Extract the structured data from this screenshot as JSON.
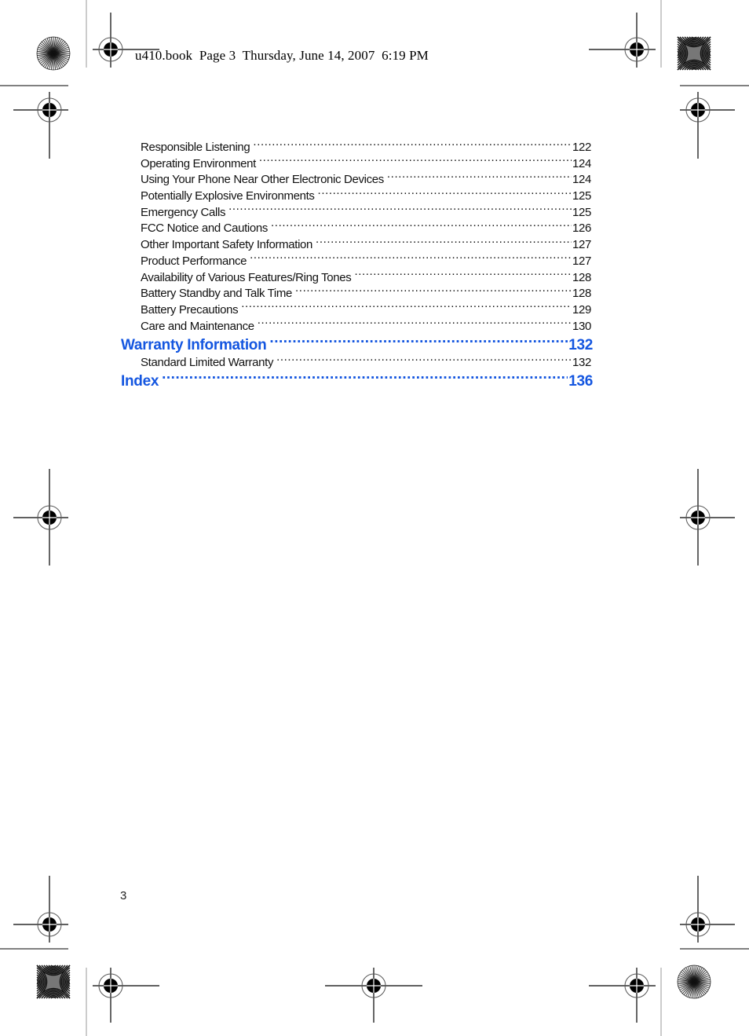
{
  "header": {
    "slug": "u410.book  Page 3  Thursday, June 14, 2007  6:19 PM"
  },
  "toc": {
    "entries": [
      {
        "level": "sub",
        "title": "Responsible Listening",
        "page": "122"
      },
      {
        "level": "sub",
        "title": "Operating Environment",
        "page": "124"
      },
      {
        "level": "sub",
        "title": "Using Your Phone Near Other Electronic Devices",
        "page": "124"
      },
      {
        "level": "sub",
        "title": "Potentially Explosive Environments",
        "page": "125"
      },
      {
        "level": "sub",
        "title": "Emergency Calls",
        "page": "125"
      },
      {
        "level": "sub",
        "title": "FCC Notice and Cautions",
        "page": "126"
      },
      {
        "level": "sub",
        "title": "Other Important Safety Information",
        "page": "127"
      },
      {
        "level": "sub",
        "title": "Product Performance",
        "page": "127"
      },
      {
        "level": "sub",
        "title": "Availability of Various Features/Ring Tones",
        "page": "128"
      },
      {
        "level": "sub",
        "title": "Battery Standby and Talk Time",
        "page": "128"
      },
      {
        "level": "sub",
        "title": "Battery Precautions",
        "page": "129"
      },
      {
        "level": "sub",
        "title": "Care and Maintenance",
        "page": "130"
      },
      {
        "level": "main",
        "title": "Warranty Information",
        "page": "132"
      },
      {
        "level": "sub",
        "title": "Standard Limited Warranty",
        "page": "132"
      },
      {
        "level": "main",
        "title": "Index",
        "page": "136"
      }
    ]
  },
  "footer": {
    "page_number": "3"
  },
  "colors": {
    "heading_blue": "#1456e0",
    "text": "#111111"
  },
  "icons": {
    "registration_mark": "registration-target-icon",
    "color_bar_radial": "starburst-target-icon",
    "color_bar_moire": "moire-target-icon"
  }
}
